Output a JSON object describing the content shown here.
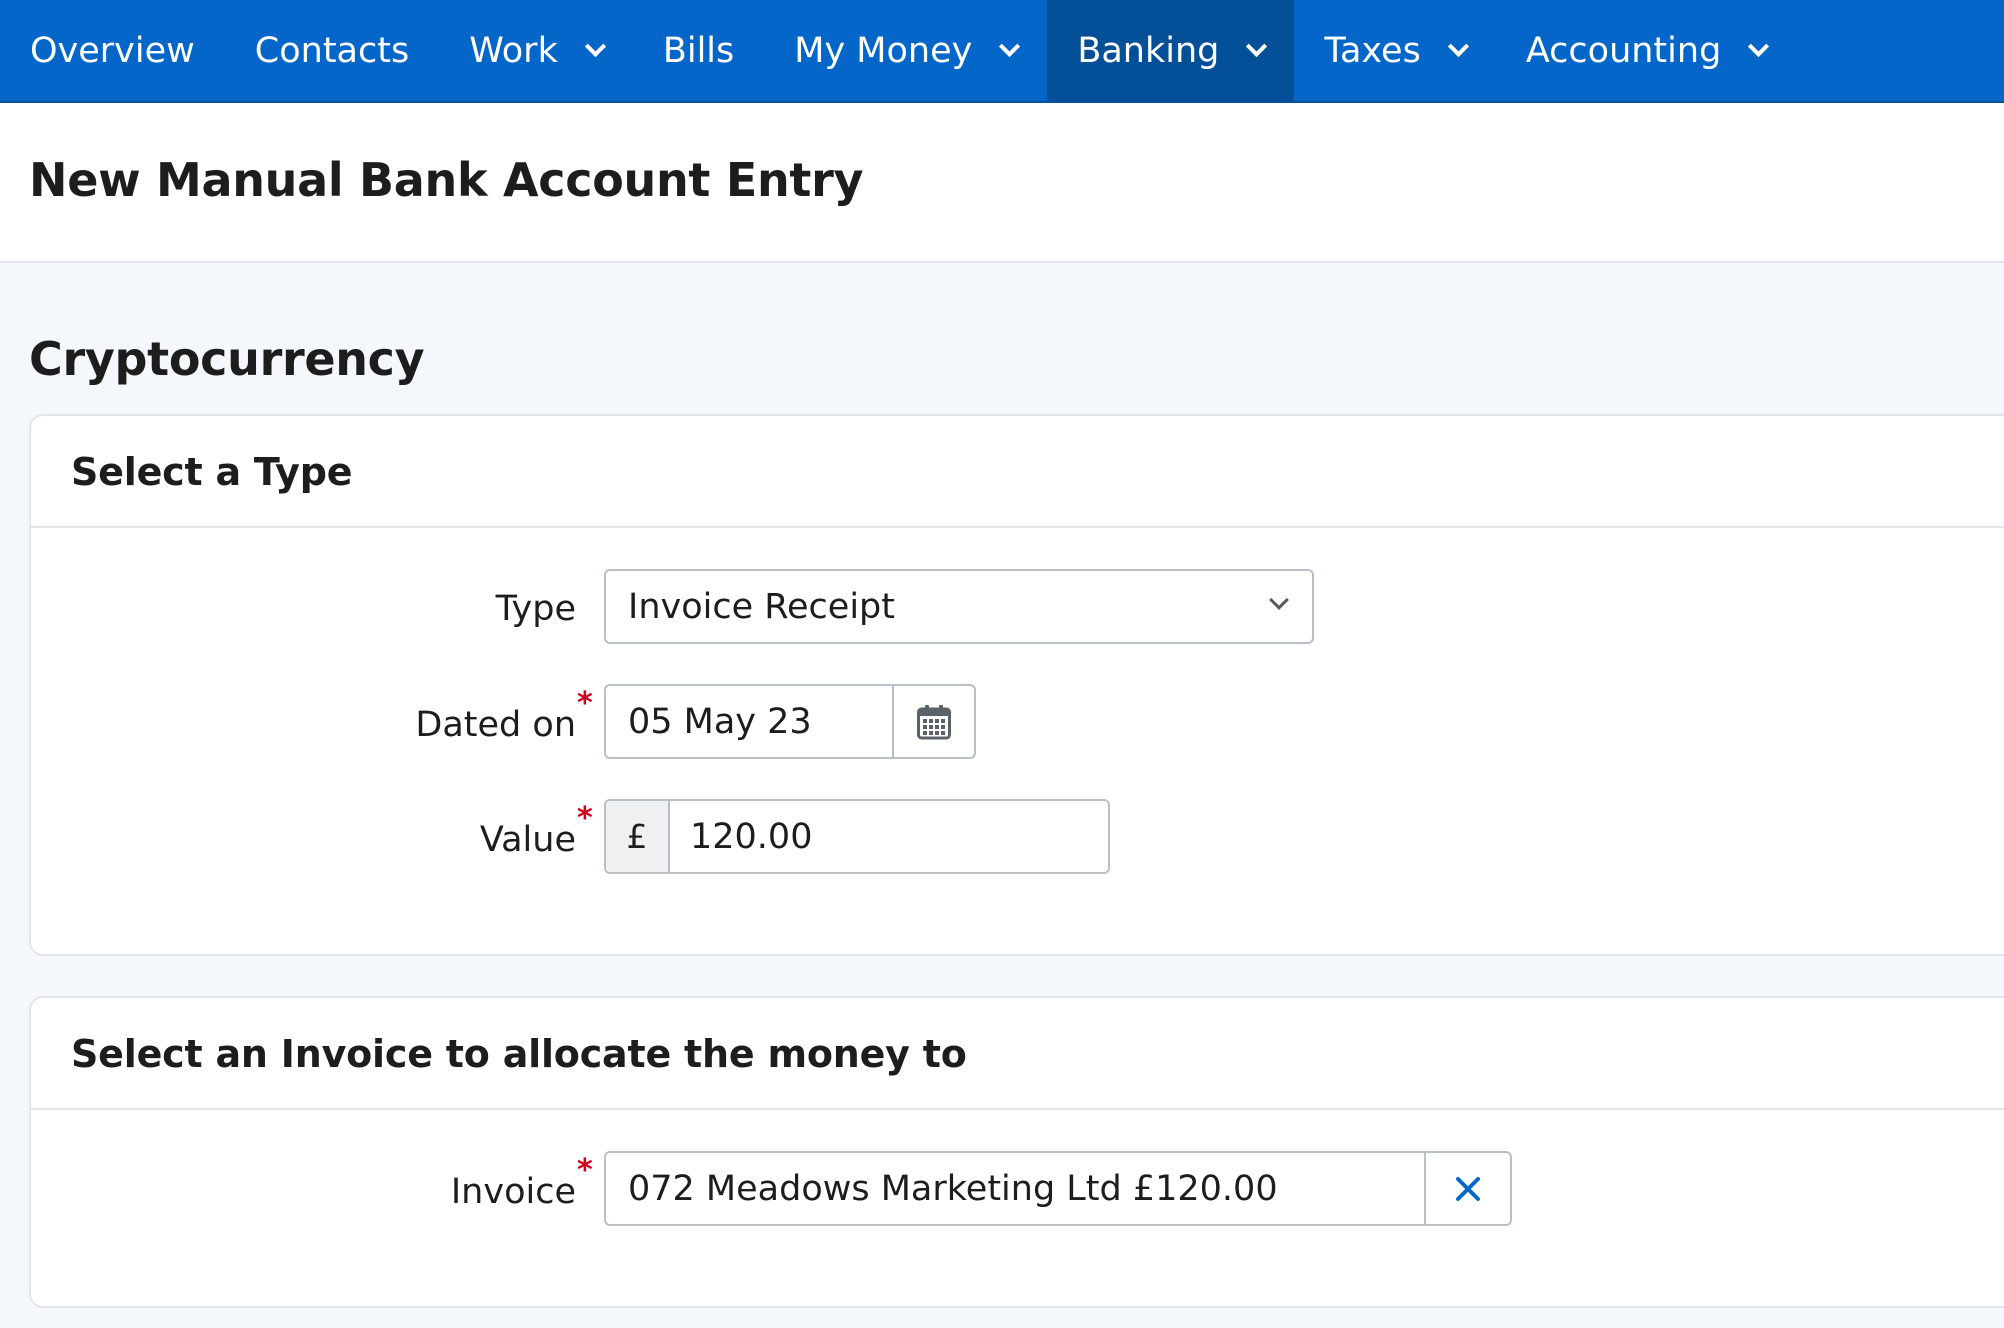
{
  "nav": {
    "items": [
      {
        "label": "Overview",
        "dropdown": false,
        "active": false
      },
      {
        "label": "Contacts",
        "dropdown": false,
        "active": false
      },
      {
        "label": "Work",
        "dropdown": true,
        "active": false
      },
      {
        "label": "Bills",
        "dropdown": false,
        "active": false
      },
      {
        "label": "My Money",
        "dropdown": true,
        "active": false
      },
      {
        "label": "Banking",
        "dropdown": true,
        "active": true
      },
      {
        "label": "Taxes",
        "dropdown": true,
        "active": false
      },
      {
        "label": "Accounting",
        "dropdown": true,
        "active": false
      }
    ]
  },
  "page": {
    "title": "New Manual Bank Account Entry",
    "section_title": "Cryptocurrency"
  },
  "type_card": {
    "title": "Select a Type",
    "type_label": "Type",
    "type_value": "Invoice Receipt",
    "date_label": "Dated on",
    "date_value": "05 May 23",
    "value_label": "Value",
    "currency_symbol": "£",
    "value_amount": "120.00",
    "required_marker": "*"
  },
  "invoice_card": {
    "title": "Select an Invoice to allocate the money to",
    "invoice_label": "Invoice",
    "invoice_value": "072 Meadows Marketing Ltd £120.00",
    "required_marker": "*"
  },
  "icons": {
    "type_select": "chevron-down-icon",
    "date_picker": "calendar-icon",
    "invoice_clear": "close-icon"
  },
  "colors": {
    "nav_bg": "#0466c8",
    "nav_active_bg": "#035098",
    "required": "#d0021b",
    "clear_icon": "#0466c8"
  }
}
